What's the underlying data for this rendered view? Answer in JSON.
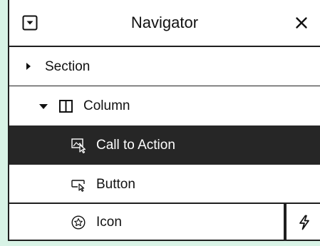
{
  "header": {
    "title": "Navigator",
    "toggle_icon": "collapse-toggle-icon",
    "close_icon": "close-icon"
  },
  "tree": {
    "section": {
      "label": "Section",
      "icon": "caret-right-icon",
      "expanded": false
    },
    "column": {
      "label": "Column",
      "icon": "column-layout-icon",
      "expanded": true
    },
    "call_to_action": {
      "label": "Call to Action",
      "icon": "call-to-action-icon",
      "selected": true
    },
    "button": {
      "label": "Button",
      "icon": "button-widget-icon"
    },
    "icon": {
      "label": "Icon",
      "icon": "star-circle-icon",
      "action_icon": "lightning-icon"
    }
  },
  "colors": {
    "background": "#d8f3e6",
    "panel": "#ffffff",
    "border": "#1f1f1f",
    "selected_row": "#262626",
    "selected_text": "#ffffff"
  }
}
